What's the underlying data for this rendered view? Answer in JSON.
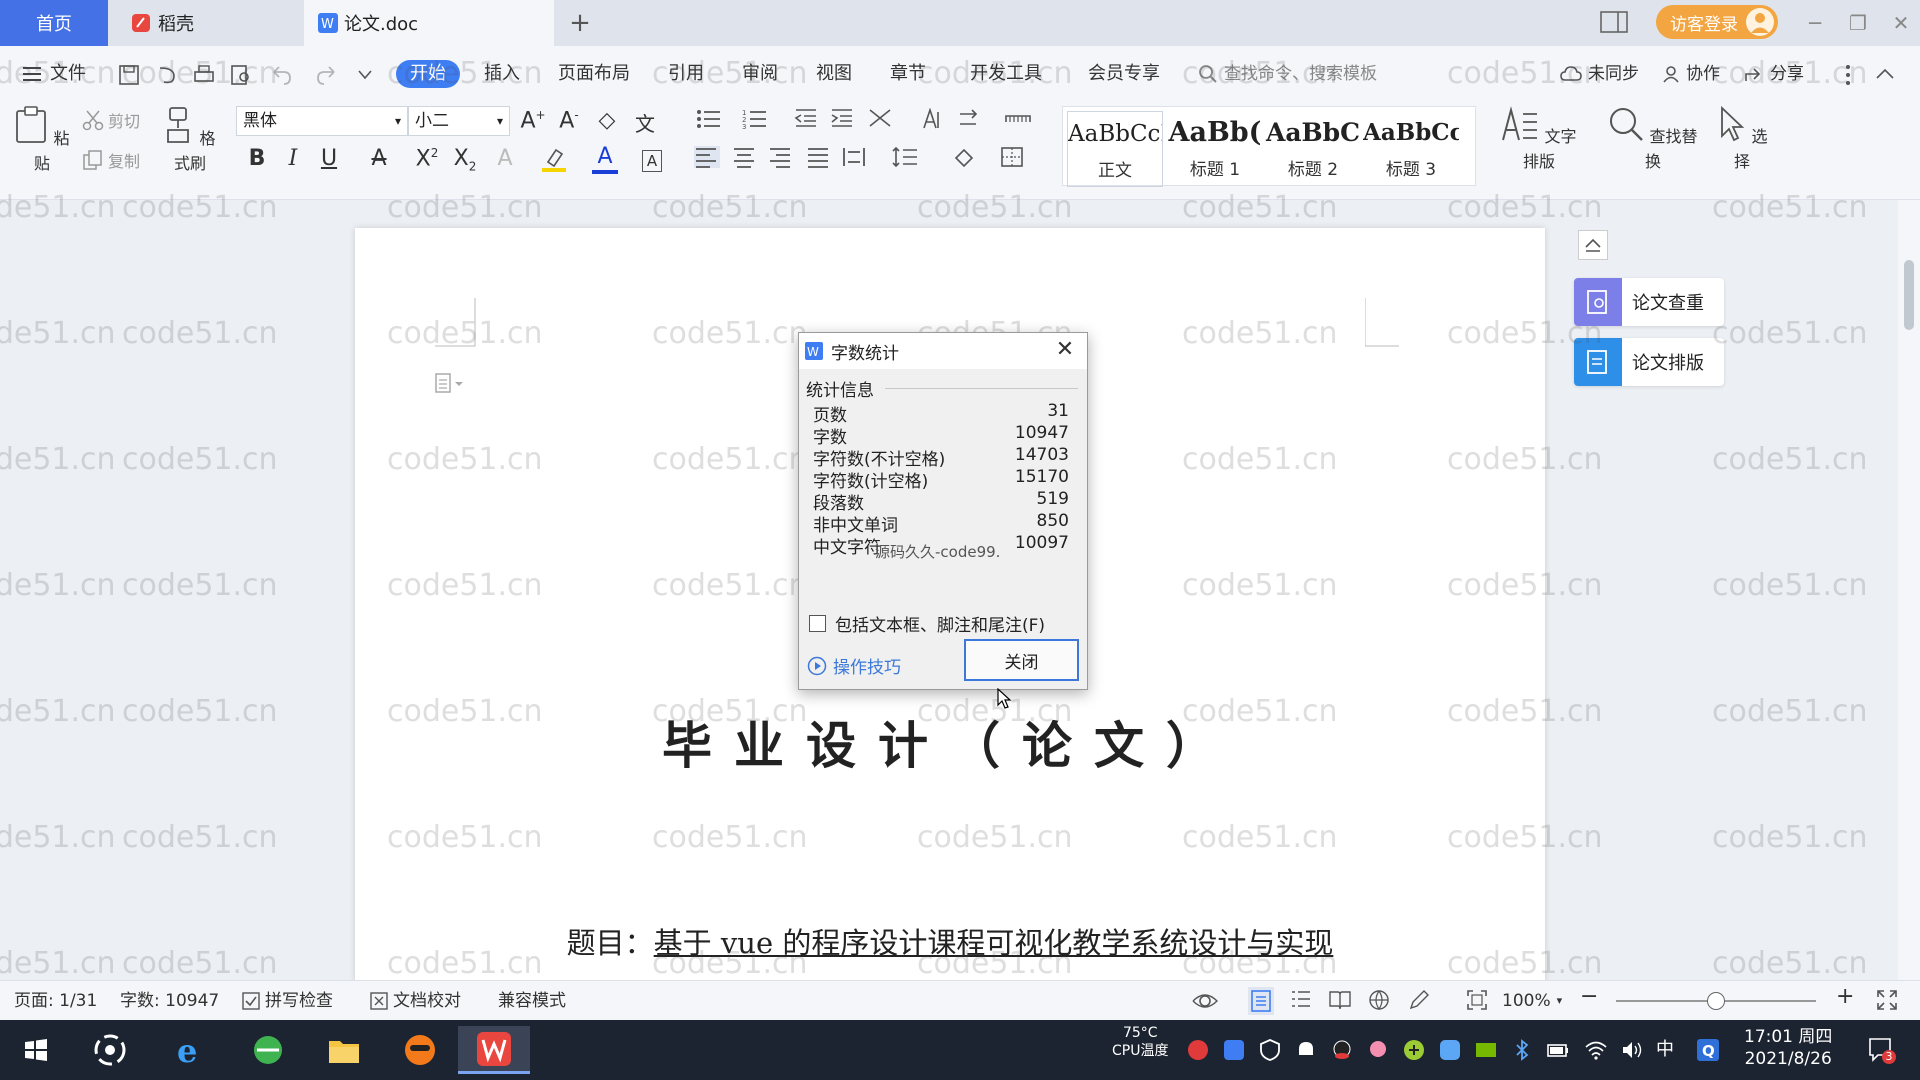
{
  "tabs": {
    "home": "首页",
    "docer": "稻壳",
    "doc": "论文.doc",
    "add": "+"
  },
  "account": {
    "login": "访客登录"
  },
  "menu": {
    "file": "文件",
    "items": [
      "开始",
      "插入",
      "页面布局",
      "引用",
      "审阅",
      "视图",
      "章节",
      "开发工具",
      "会员专享"
    ],
    "search_placeholder": "查找命令、搜索模板",
    "sync": "未同步",
    "collab": "协作",
    "share": "分享"
  },
  "ribbon": {
    "paste": "粘贴",
    "cut": "剪切",
    "copy": "复制",
    "format_painter": "格式刷",
    "font": "黑体",
    "size": "小二",
    "styles": [
      {
        "sample": "AaBbCcI",
        "label": "正文"
      },
      {
        "sample": "AaBb(",
        "label": "标题 1"
      },
      {
        "sample": "AaBbC",
        "label": "标题 2"
      },
      {
        "sample": "AaBbCcl",
        "label": "标题 3"
      }
    ],
    "text_layout": "文字排版",
    "find_replace": "查找替换",
    "select": "选择"
  },
  "document": {
    "title": "毕业设计（论文）",
    "topic_label": "题目：",
    "topic": "基于 vue 的程序设计课程可视化教学系统设计与实现"
  },
  "side_panel": {
    "check": "论文查重",
    "layout": "论文排版"
  },
  "dialog": {
    "title": "字数统计",
    "section": "统计信息",
    "stats": [
      {
        "label": "页数",
        "value": "31"
      },
      {
        "label": "字数",
        "value": "10947"
      },
      {
        "label": "字符数(不计空格)",
        "value": "14703"
      },
      {
        "label": "字符数(计空格)",
        "value": "15170"
      },
      {
        "label": "段落数",
        "value": "519"
      },
      {
        "label": "非中文单词",
        "value": "850"
      },
      {
        "label": "中文字符",
        "value": "10097"
      }
    ],
    "overlay_watermark": "源码久久-code99.",
    "include_checkbox": "包括文本框、脚注和尾注(F)",
    "include_checked": false,
    "tips": "操作技巧",
    "close": "关闭"
  },
  "statusbar": {
    "page": "页面: 1/31",
    "words": "字数: 10947",
    "spell": "拼写检查",
    "proofread": "文档校对",
    "compat": "兼容模式",
    "zoom": "100%",
    "zoom_level": 1.0
  },
  "taskbar": {
    "cpu_temp": "75°C",
    "cpu_label": "CPU温度",
    "ime": "中",
    "time": "17:01 周四",
    "date": "2021/8/26",
    "notif_count": "3"
  },
  "watermark": "code51.cn",
  "colors": {
    "accent": "#3f7df3",
    "tab_home": "#4472e6",
    "login": "#f2a541",
    "taskbar": "#1c2431"
  }
}
